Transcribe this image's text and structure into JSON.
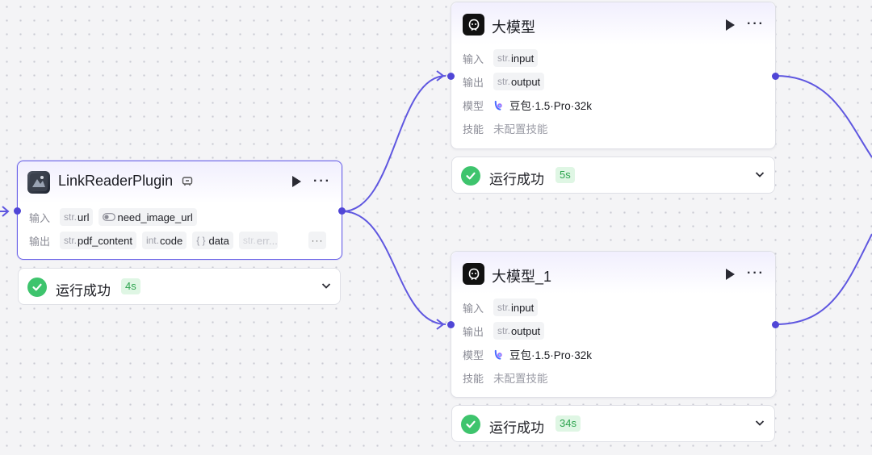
{
  "colors": {
    "accent": "#5046d6",
    "success": "#3ec46d",
    "badge_bg": "#dff6e4",
    "badge_text": "#2ea44f"
  },
  "plugin_node": {
    "title": "LinkReaderPlugin",
    "icon": "plugin-app-icon",
    "input_label": "输入",
    "output_label": "输出",
    "inputs": [
      {
        "type": "str.",
        "name": "url"
      },
      {
        "type": "",
        "name": "need_image_url",
        "icon": "toggle-icon"
      }
    ],
    "outputs": [
      {
        "type": "str.",
        "name": "pdf_content"
      },
      {
        "type": "int.",
        "name": "code"
      },
      {
        "type": "{ }",
        "name": "data"
      },
      {
        "type": "str.",
        "name": "err..."
      }
    ],
    "overflow_label": "···",
    "status": {
      "text": "运行成功",
      "time": "4s"
    }
  },
  "llm_node_1": {
    "title": "大模型",
    "input_label": "输入",
    "output_label": "输出",
    "model_label": "模型",
    "skill_label": "技能",
    "input": {
      "type": "str.",
      "name": "input"
    },
    "output": {
      "type": "str.",
      "name": "output"
    },
    "model": "豆包·1.5·Pro·32k",
    "skill": "未配置技能",
    "status": {
      "text": "运行成功",
      "time": "5s"
    }
  },
  "llm_node_2": {
    "title": "大模型_1",
    "input_label": "输入",
    "output_label": "输出",
    "model_label": "模型",
    "skill_label": "技能",
    "input": {
      "type": "str.",
      "name": "input"
    },
    "output": {
      "type": "str.",
      "name": "output"
    },
    "model": "豆包·1.5·Pro·32k",
    "skill": "未配置技能",
    "status": {
      "text": "运行成功",
      "time": "34s"
    }
  },
  "more_glyph": "···"
}
